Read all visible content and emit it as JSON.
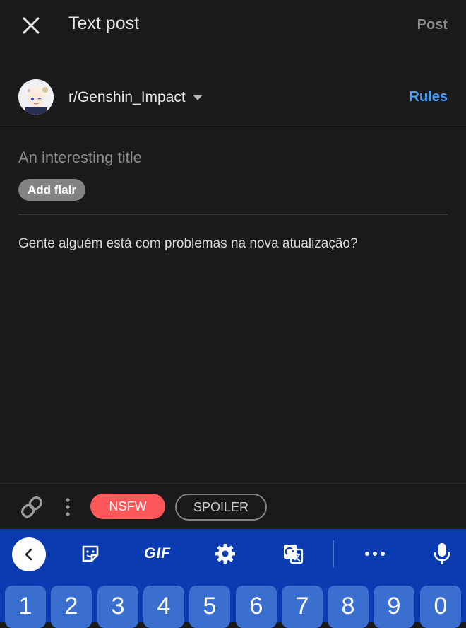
{
  "header": {
    "title": "Text post",
    "post_label": "Post"
  },
  "community": {
    "name": "r/Genshin_Impact",
    "rules_label": "Rules"
  },
  "composer": {
    "title_placeholder": "An interesting title",
    "flair_label": "Add flair",
    "body_text": "Gente alguém está com problemas na nova atualização?"
  },
  "toolbar": {
    "nsfw_label": "NSFW",
    "spoiler_label": "SPOILER"
  },
  "keyboard": {
    "gif_label": "GIF",
    "number_keys": [
      "1",
      "2",
      "3",
      "4",
      "5",
      "6",
      "7",
      "8",
      "9",
      "0"
    ]
  },
  "colors": {
    "background": "#1a1a1b",
    "accent_blue": "#4a9ef7",
    "nsfw_red": "#ff585b",
    "keyboard_blue": "#0a3bb0"
  }
}
